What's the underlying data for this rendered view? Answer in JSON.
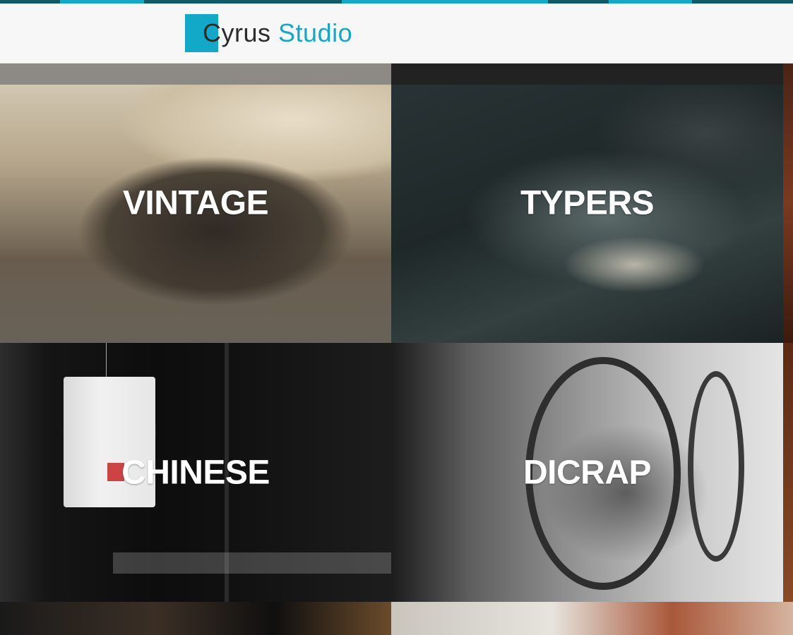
{
  "brand": {
    "first_word": "Cyrus",
    "second_word": "Studio"
  },
  "colors": {
    "accent": "#12a8c8",
    "accent_dark": "#0b5a66",
    "header_bg": "#f7f7f7",
    "label": "#ffffff"
  },
  "tiles": [
    {
      "label": "VINTAGE"
    },
    {
      "label": "TYPERS"
    },
    {
      "label": "CHINESE"
    },
    {
      "label": "DICRAP"
    }
  ]
}
